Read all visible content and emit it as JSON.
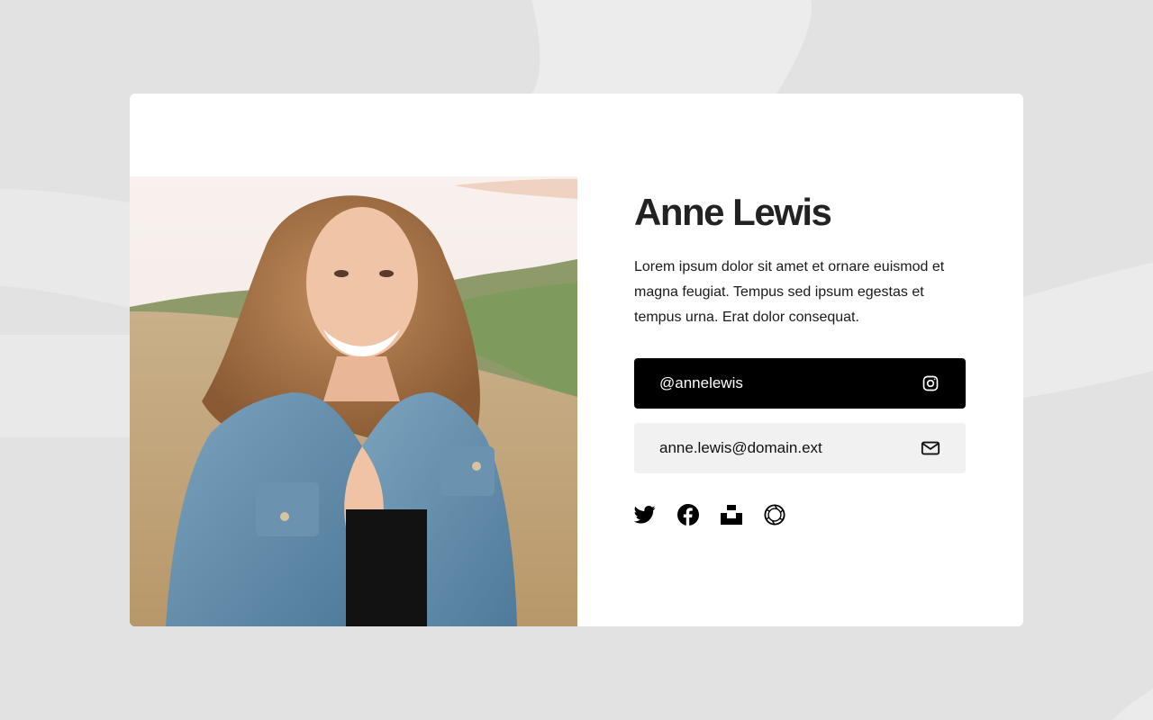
{
  "profile": {
    "name": "Anne Lewis",
    "bio": "Lorem ipsum dolor sit amet et ornare euismod et magna feugiat. Tempus sed ipsum egestas et tempus urna. Erat dolor consequat."
  },
  "contacts": {
    "instagram": {
      "label": "@annelewis",
      "icon": "instagram-icon"
    },
    "email": {
      "label": "anne.lewis@domain.ext",
      "icon": "mail-icon"
    }
  },
  "socials": [
    {
      "icon": "twitter-icon"
    },
    {
      "icon": "facebook-icon"
    },
    {
      "icon": "unsplash-icon"
    },
    {
      "icon": "aperture-icon"
    }
  ],
  "colors": {
    "background": "#e2e2e2",
    "card": "#ffffff",
    "primary_button": "#000000",
    "secondary_button": "#f1f1f1",
    "heading": "#222222"
  }
}
